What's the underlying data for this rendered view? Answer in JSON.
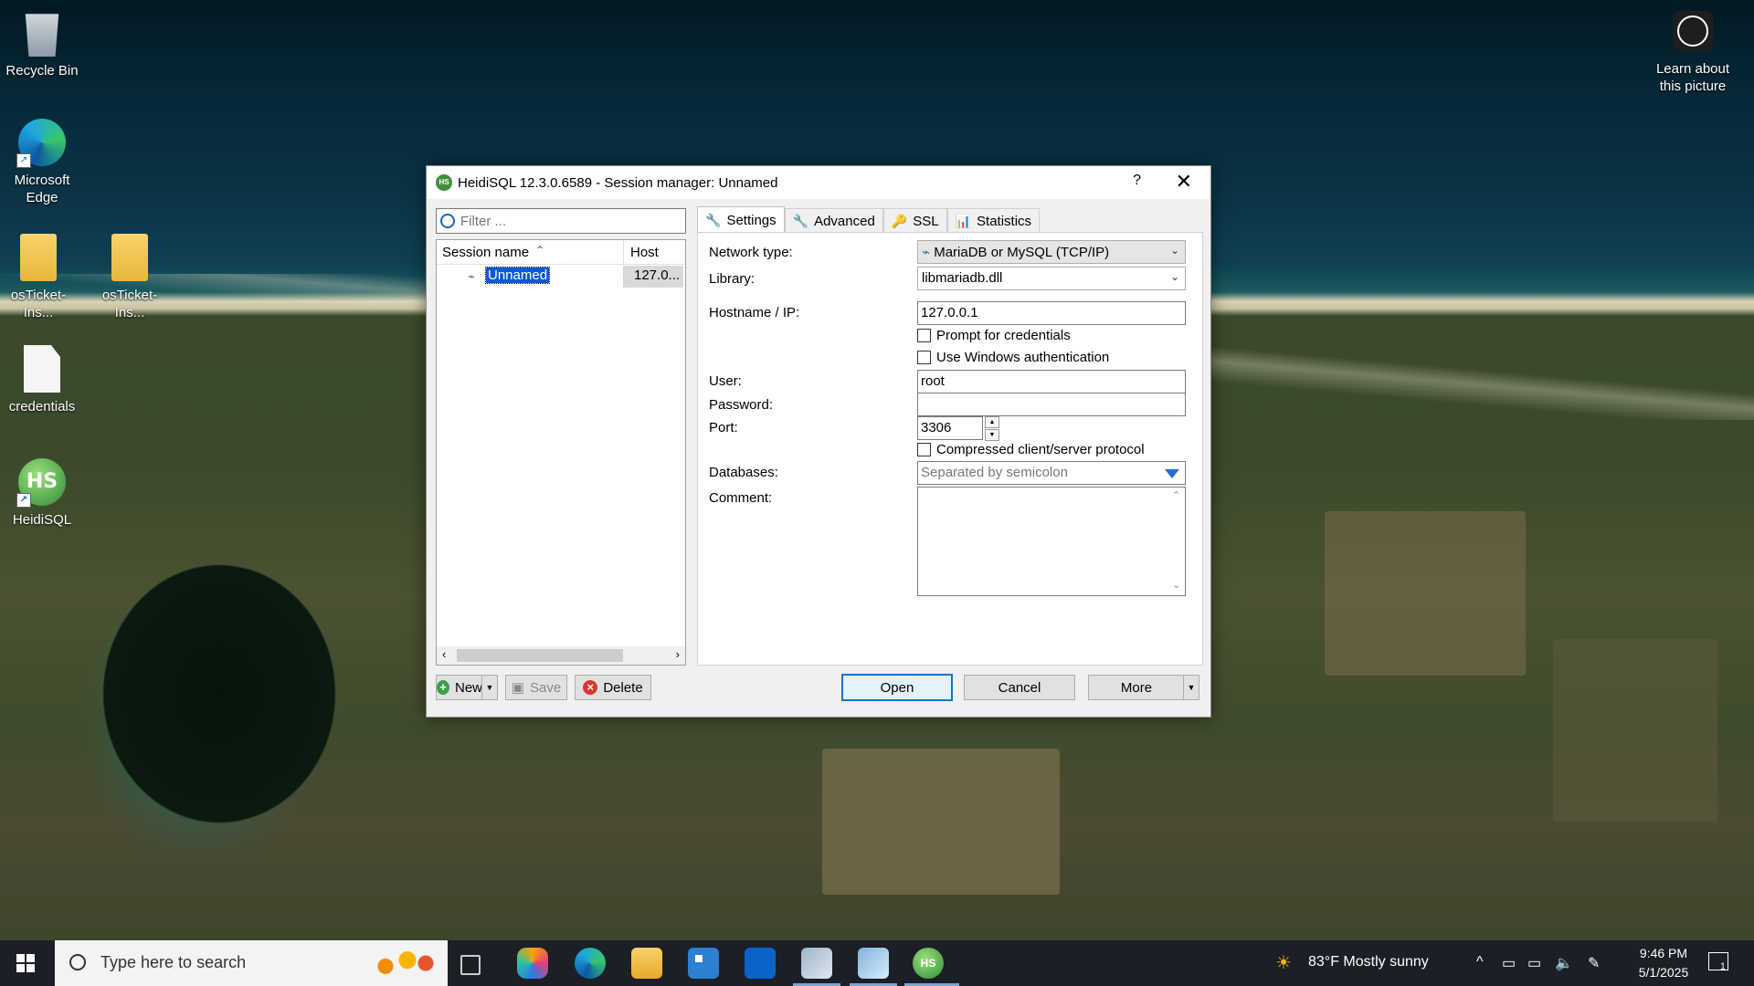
{
  "desktop": {
    "icons": {
      "recycle_bin": "Recycle Bin",
      "edge": "Microsoft Edge",
      "osticket1": "osTicket-Ins...",
      "osticket2": "osTicket-Ins...",
      "credentials": "credentials",
      "heidisql": "HeidiSQL"
    },
    "learn_about": "Learn about this picture"
  },
  "window": {
    "title": "HeidiSQL 12.3.0.6589 - Session manager: Unnamed",
    "help_label": "?",
    "close_label": "✕",
    "filter_placeholder": "Filter ...",
    "session_list": {
      "col_name": "Session name",
      "col_host": "Host",
      "rows": [
        {
          "name": "Unnamed",
          "host": "127.0..."
        }
      ]
    },
    "tabs": [
      {
        "label": "Settings",
        "icon": "wrench-icon"
      },
      {
        "label": "Advanced",
        "icon": "wrench-orange-icon"
      },
      {
        "label": "SSL",
        "icon": "key-icon"
      },
      {
        "label": "Statistics",
        "icon": "bar-chart-icon"
      }
    ],
    "settings": {
      "network_type_label": "Network type:",
      "network_type_value": "MariaDB or MySQL (TCP/IP)",
      "library_label": "Library:",
      "library_value": "libmariadb.dll",
      "hostname_label": "Hostname / IP:",
      "hostname_value": "127.0.0.1",
      "prompt_credentials": "Prompt for credentials",
      "windows_auth": "Use Windows authentication",
      "user_label": "User:",
      "user_value": "root",
      "password_label": "Password:",
      "password_value": "",
      "port_label": "Port:",
      "port_value": "3306",
      "compressed": "Compressed client/server protocol",
      "databases_label": "Databases:",
      "databases_placeholder": "Separated by semicolon",
      "comment_label": "Comment:"
    },
    "buttons": {
      "new": "New",
      "save": "Save",
      "delete": "Delete",
      "open": "Open",
      "cancel": "Cancel",
      "more": "More"
    }
  },
  "taskbar": {
    "search_placeholder": "Type here to search",
    "weather": "83°F  Mostly sunny",
    "time": "9:46 PM",
    "date": "5/1/2025",
    "notification_count": "1"
  }
}
